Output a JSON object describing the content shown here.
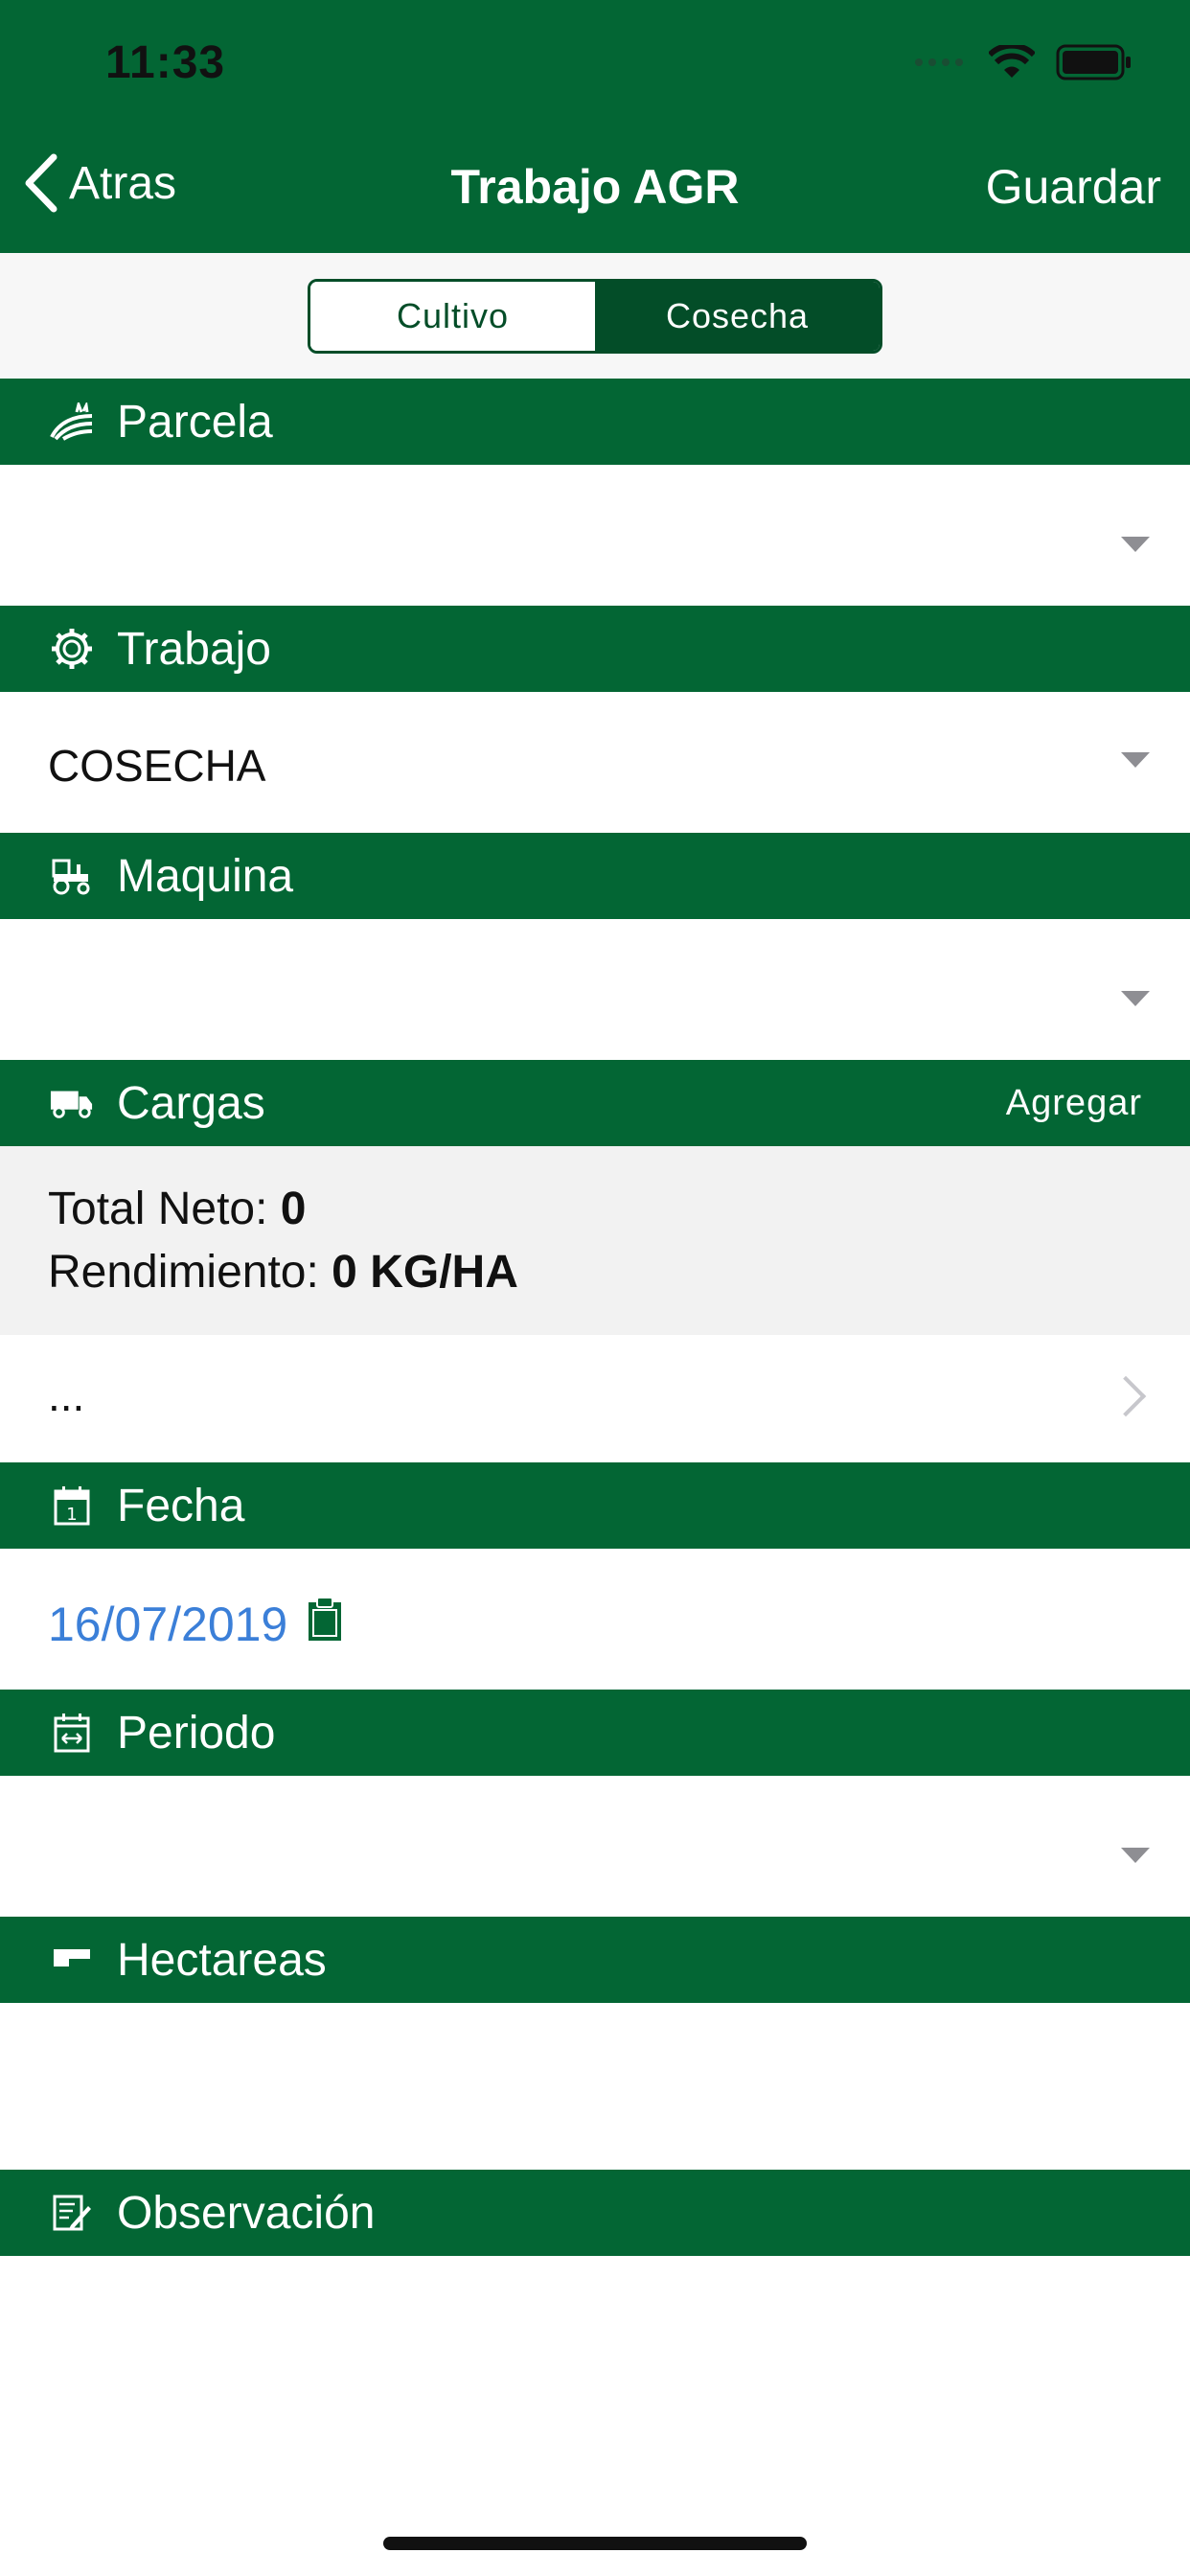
{
  "status_bar": {
    "time": "11:33"
  },
  "nav": {
    "back_label": "Atras",
    "title": "Trabajo AGR",
    "save_label": "Guardar"
  },
  "segments": {
    "cultivo": "Cultivo",
    "cosecha": "Cosecha",
    "selected": "Cosecha"
  },
  "sections": {
    "parcela": {
      "title": "Parcela",
      "value": ""
    },
    "trabajo": {
      "title": "Trabajo",
      "value": "COSECHA"
    },
    "maquina": {
      "title": "Maquina",
      "value": ""
    },
    "cargas": {
      "title": "Cargas",
      "action": "Agregar",
      "total_neto_label": "Total Neto:",
      "total_neto_value": "0",
      "rendimiento_label": "Rendimiento:",
      "rendimiento_value": "0 KG/HA",
      "list_item": "..."
    },
    "fecha": {
      "title": "Fecha",
      "value": "16/07/2019"
    },
    "periodo": {
      "title": "Periodo",
      "value": ""
    },
    "hectareas": {
      "title": "Hectareas",
      "value": ""
    },
    "observacion": {
      "title": "Observación",
      "value": ""
    }
  },
  "colors": {
    "primary": "#036634",
    "segment_dark": "#034d28",
    "link_blue": "#3b7fd8"
  }
}
